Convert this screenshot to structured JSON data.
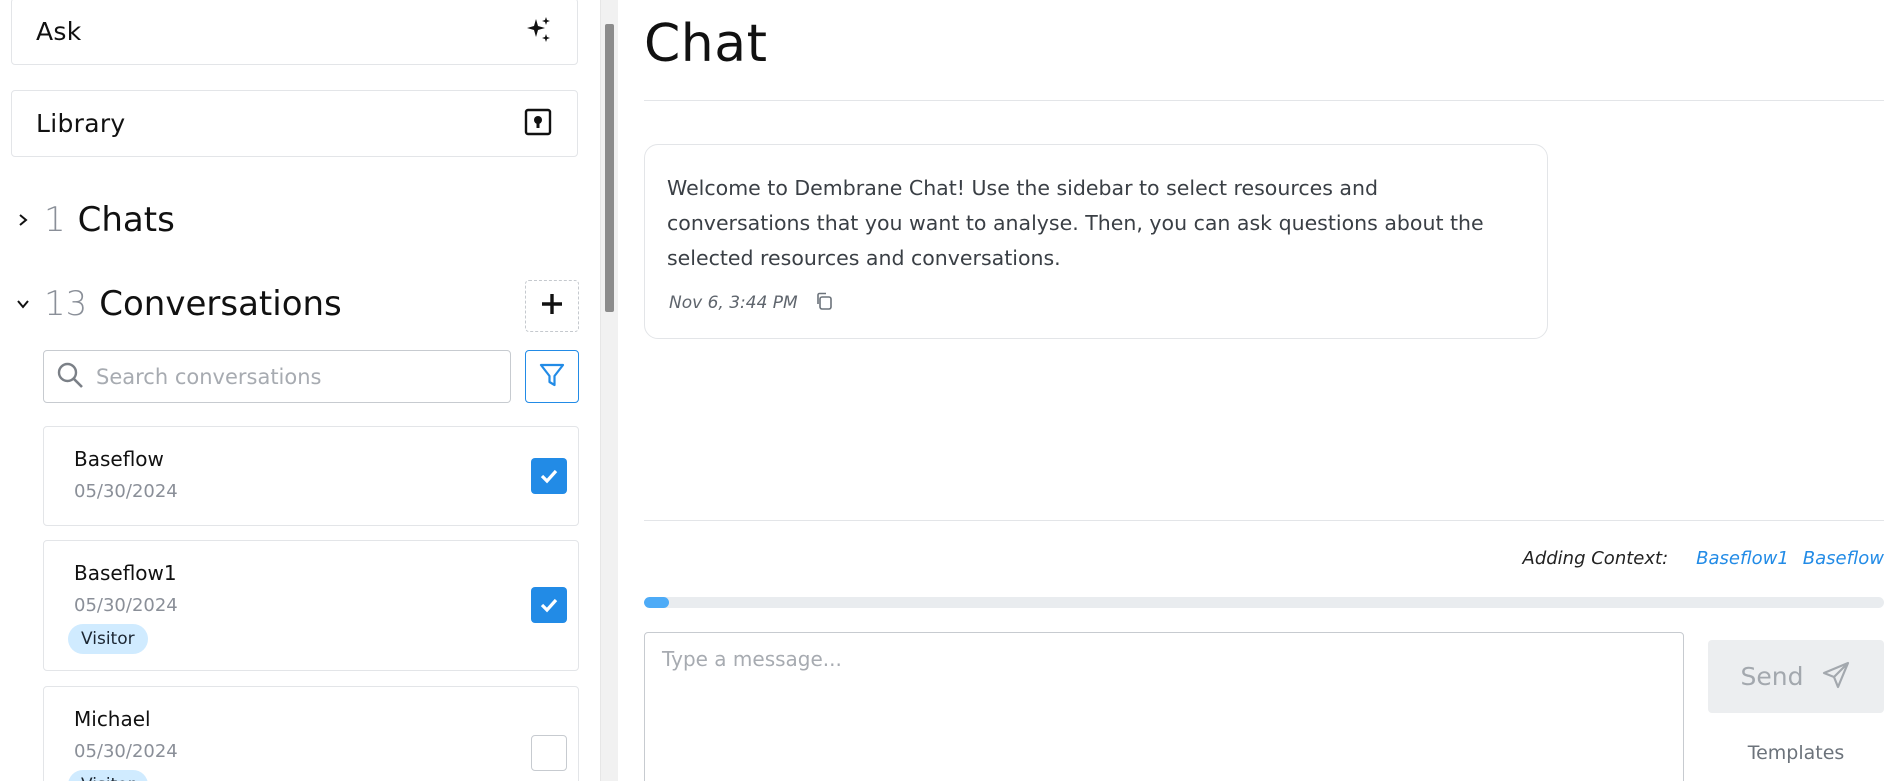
{
  "sidebar": {
    "ask_label": "Ask",
    "library_label": "Library",
    "chats": {
      "count": "1",
      "title": "Chats"
    },
    "conversations": {
      "count": "13",
      "title": "Conversations"
    },
    "search": {
      "placeholder": "Search conversations"
    },
    "items": [
      {
        "name": "Baseflow",
        "date": "05/30/2024",
        "tag": "",
        "checked": true
      },
      {
        "name": "Baseflow1",
        "date": "05/30/2024",
        "tag": "Visitor",
        "checked": true
      },
      {
        "name": "Michael",
        "date": "05/30/2024",
        "tag": "Visitor",
        "checked": false
      }
    ]
  },
  "main": {
    "title": "Chat",
    "message": {
      "text": "Welcome to Dembrane Chat! Use the sidebar to select resources and conversations that you want to analyse. Then, you can ask questions about the selected resources and conversations.",
      "time": "Nov 6, 3:44 PM"
    },
    "context": {
      "label": "Adding Context:",
      "items": [
        "Baseflow1",
        "Baseflow"
      ]
    },
    "progress": 0.02,
    "input": {
      "placeholder": "Type a message..."
    },
    "send_label": "Send",
    "templates_label": "Templates"
  },
  "colors": {
    "accent": "#228be6",
    "tag_bg": "#d0ebff",
    "progress_fill": "#4dabf7"
  }
}
